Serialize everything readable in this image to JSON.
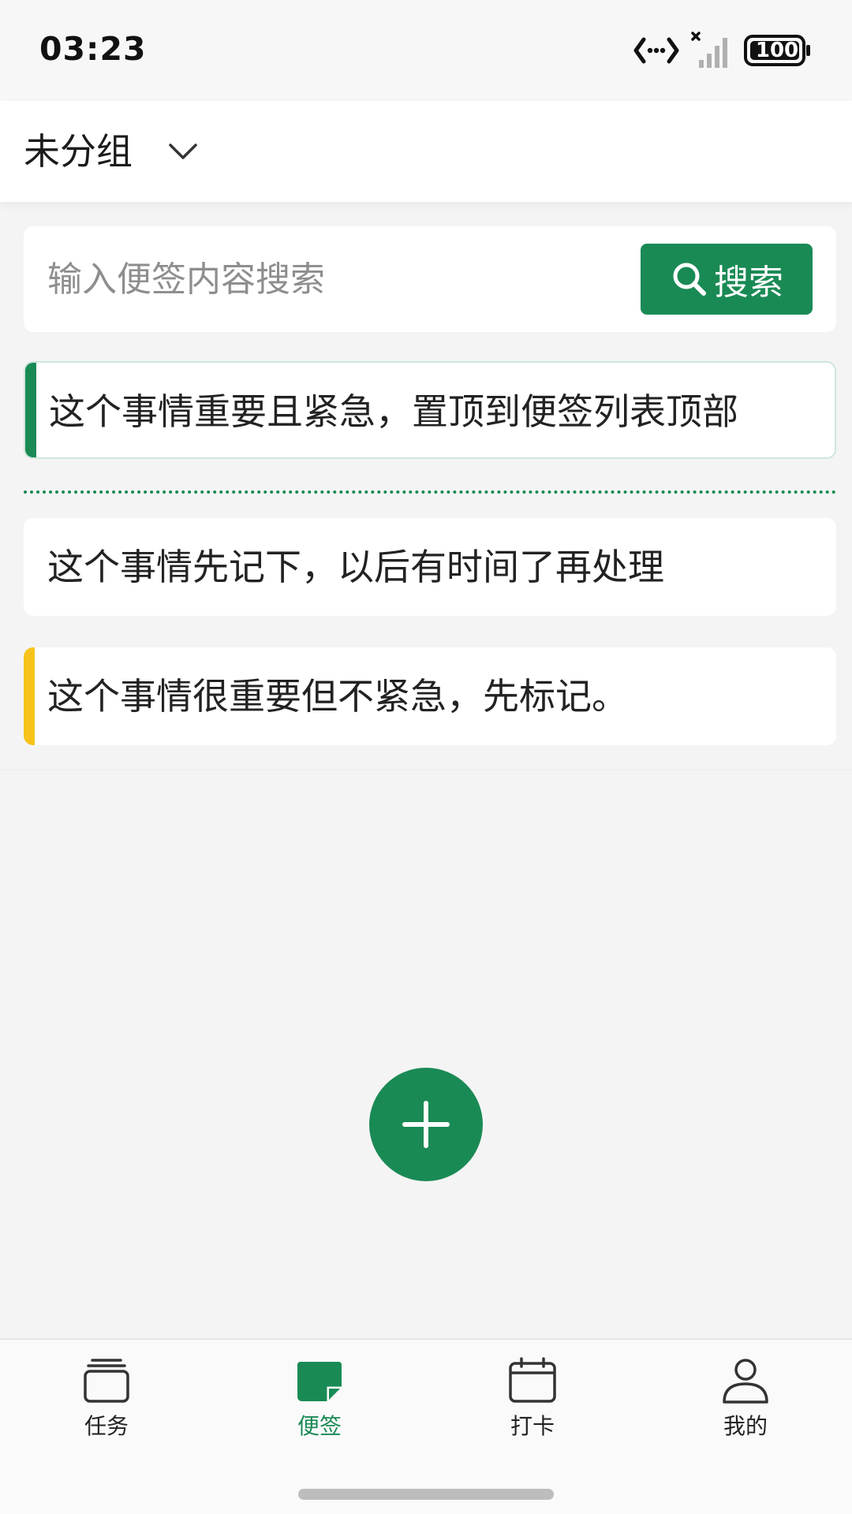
{
  "status_bar": {
    "time": "03:23",
    "battery": "100",
    "icons": [
      "data-transfer-icon",
      "signal-icon",
      "battery-icon"
    ]
  },
  "header": {
    "group_title": "未分组",
    "chevron_icon": "chevron-down-icon"
  },
  "search": {
    "placeholder": "输入便签内容搜索",
    "value": "",
    "button_label": "搜索",
    "icon": "search-icon"
  },
  "notes": [
    {
      "text": "这个事情重要且紧急，置顶到便签列表顶部",
      "marker_color": "#1a8a55",
      "pinned": true
    },
    {
      "text": "这个事情先记下，以后有时间了再处理",
      "marker_color": "",
      "pinned": false
    },
    {
      "text": "这个事情很重要但不紧急，先标记。",
      "marker_color": "#f7c31b",
      "pinned": false
    }
  ],
  "fab": {
    "icon": "plus-icon"
  },
  "bottom_nav": {
    "items": [
      {
        "label": "任务",
        "icon": "task-stack-icon",
        "active": false
      },
      {
        "label": "便签",
        "icon": "sticky-note-icon",
        "active": true
      },
      {
        "label": "打卡",
        "icon": "calendar-icon",
        "active": false
      },
      {
        "label": "我的",
        "icon": "user-icon",
        "active": false
      }
    ]
  },
  "colors": {
    "accent": "#1a8a55",
    "important": "#f7c31b",
    "background": "#f4f4f4"
  }
}
